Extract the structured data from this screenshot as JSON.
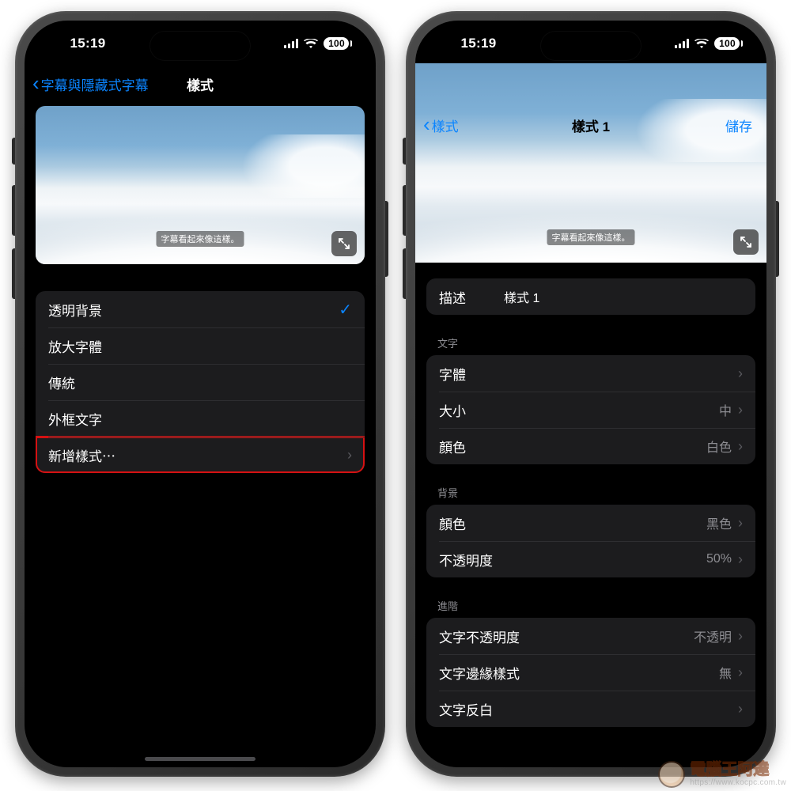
{
  "status": {
    "time": "15:19",
    "battery": "100"
  },
  "preview_caption": "字幕看起來像這樣。",
  "watermark": {
    "brand": "電腦王阿達",
    "url": "https://www.kocpc.com.tw"
  },
  "left": {
    "back_label": "字幕與隱藏式字幕",
    "title": "樣式",
    "options": [
      {
        "label": "透明背景",
        "checked": true
      },
      {
        "label": "放大字體",
        "checked": false
      },
      {
        "label": "傳統",
        "checked": false
      },
      {
        "label": "外框文字",
        "checked": false
      }
    ],
    "create_label": "新增樣式⋯"
  },
  "right": {
    "back_label": "樣式",
    "title": "樣式 1",
    "save_label": "儲存",
    "desc": {
      "label": "描述",
      "value": "樣式 1"
    },
    "section_text": "文字",
    "text_rows": {
      "font": {
        "label": "字體",
        "value": ""
      },
      "size": {
        "label": "大小",
        "value": "中"
      },
      "color": {
        "label": "顏色",
        "value": "白色"
      }
    },
    "section_bg": "背景",
    "bg_rows": {
      "color": {
        "label": "顏色",
        "value": "黑色"
      },
      "opacity": {
        "label": "不透明度",
        "value": "50%"
      }
    },
    "section_adv": "進階",
    "adv_rows": {
      "text_opacity": {
        "label": "文字不透明度",
        "value": "不透明"
      },
      "edge_style": {
        "label": "文字邊緣樣式",
        "value": "無"
      },
      "invert": {
        "label": "文字反白",
        "value": ""
      }
    }
  }
}
